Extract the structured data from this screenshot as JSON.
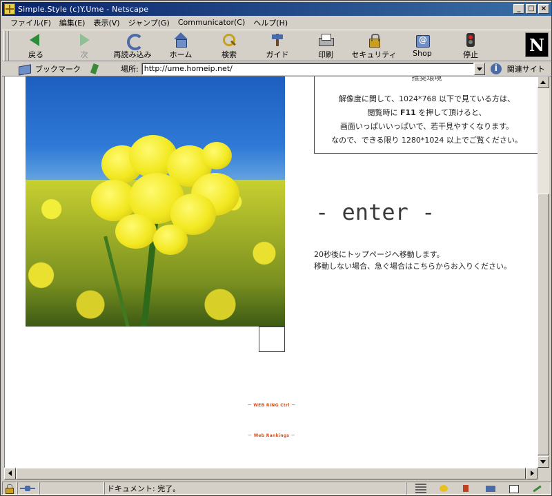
{
  "window": {
    "title": "Simple.Style (c)Y.Ume - Netscape",
    "controls": {
      "minimize": "_",
      "maximize": "□",
      "close": "×"
    }
  },
  "menu": [
    {
      "label": "ファイル(F)"
    },
    {
      "label": "編集(E)"
    },
    {
      "label": "表示(V)"
    },
    {
      "label": "ジャンプ(G)"
    },
    {
      "label": "Communicator(C)"
    },
    {
      "label": "ヘルプ(H)"
    }
  ],
  "toolbar": {
    "back": "戻る",
    "forward": "次",
    "reload": "再読み込み",
    "home": "ホーム",
    "search": "検索",
    "guide": "ガイド",
    "print": "印刷",
    "security": "セキュリティ",
    "shop": "Shop",
    "stop": "停止",
    "logo": "N"
  },
  "location": {
    "bookmarks_label": "ブックマーク",
    "location_label": "場所:",
    "url": "http://ume.homeip.net/",
    "related_label": "関連サイト"
  },
  "content": {
    "infobox_top_fragment": "推奨環境",
    "infobox_lines": [
      "解像度に関して、1024*768 以下で見ている方は、",
      "閲覧時に ",
      "F11",
      " を押して頂けると、",
      "画面いっぱいいっぱいで、若干見やすくなります。",
      "なので、できる限り 1280*1024 以上でご覧ください。"
    ],
    "enter_link": "- enter -",
    "redirect_line1": "20秒後にトップページへ移動します。",
    "redirect_line2": "移動しない場合、急ぐ場合はこちらからお入りください。",
    "badge1": "－ WEB RING Ctrl －",
    "badge2": "－ Web Rankings －"
  },
  "status": {
    "text": "ドキュメント: 完了。"
  }
}
